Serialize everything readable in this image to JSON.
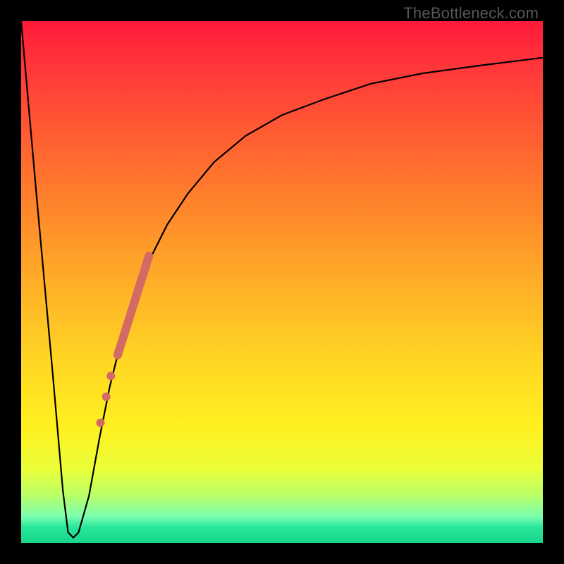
{
  "watermark": "TheBottleneck.com",
  "chart_data": {
    "type": "line",
    "title": "",
    "xlabel": "",
    "ylabel": "",
    "xlim": [
      0,
      100
    ],
    "ylim": [
      0,
      100
    ],
    "grid": false,
    "series": [
      {
        "name": "bottleneck-curve",
        "x": [
          0,
          3,
          6,
          8,
          9,
          10,
          11,
          13,
          15,
          17,
          19,
          21,
          24,
          28,
          32,
          37,
          43,
          50,
          58,
          67,
          77,
          88,
          100
        ],
        "y": [
          100,
          66,
          33,
          10,
          2,
          1,
          2,
          9,
          20,
          30,
          38,
          45,
          53,
          61,
          67,
          73,
          78,
          82,
          85,
          88,
          90,
          91.5,
          93
        ]
      }
    ],
    "highlight_segment": {
      "name": "marked-range",
      "x": [
        18.5,
        24.5
      ],
      "y": [
        36,
        55
      ]
    },
    "highlight_points": {
      "name": "marked-dots",
      "x": [
        17.2,
        16.3,
        15.2
      ],
      "y": [
        32,
        28,
        23
      ]
    },
    "background_gradient": {
      "top_color": "#ff1a3a",
      "mid_color": "#ffd624",
      "bottom_color": "#18d688"
    }
  }
}
